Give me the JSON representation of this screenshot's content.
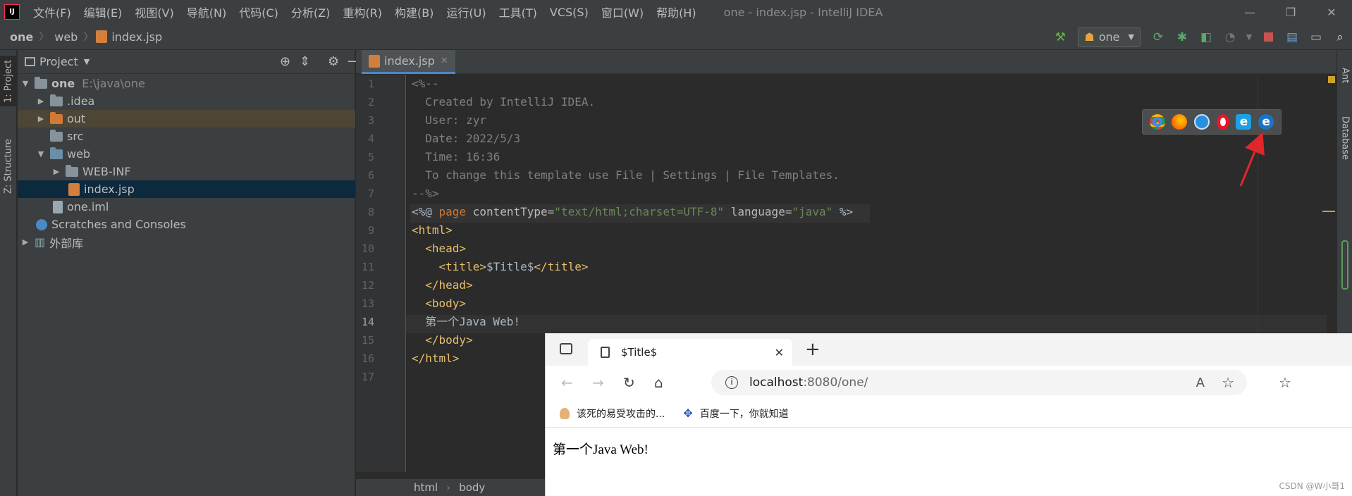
{
  "app": {
    "logo_text": "IJ",
    "window_title": "one - index.jsp - IntelliJ IDEA",
    "menu": [
      "文件(F)",
      "编辑(E)",
      "视图(V)",
      "导航(N)",
      "代码(C)",
      "分析(Z)",
      "重构(R)",
      "构建(B)",
      "运行(U)",
      "工具(T)",
      "VCS(S)",
      "窗口(W)",
      "帮助(H)"
    ],
    "window_controls": [
      "—",
      "❐",
      "✕"
    ]
  },
  "breadcrumb": [
    "one",
    "web",
    "index.jsp"
  ],
  "toolbar": {
    "run_config": "one"
  },
  "left_stripe": {
    "project_tab": "1: Project",
    "structure_tab": "Z: Structure"
  },
  "right_stripe": {
    "ant_tab": "Ant",
    "database_tab": "Database"
  },
  "project_panel": {
    "title": "Project",
    "tree": [
      {
        "label": "one",
        "path": "E:\\java\\one"
      },
      {
        "label": ".idea"
      },
      {
        "label": "out"
      },
      {
        "label": "src"
      },
      {
        "label": "web"
      },
      {
        "label": "WEB-INF"
      },
      {
        "label": "index.jsp"
      },
      {
        "label": "one.iml"
      },
      {
        "label": "Scratches and Consoles"
      },
      {
        "label": "外部库"
      }
    ]
  },
  "editor": {
    "tab": "index.jsp",
    "line_numbers": [
      "1",
      "2",
      "3",
      "4",
      "5",
      "6",
      "7",
      "8",
      "9",
      "10",
      "11",
      "12",
      "13",
      "14",
      "15",
      "16",
      "17"
    ],
    "code": {
      "l1": "<%--",
      "l2": "  Created by IntelliJ IDEA.",
      "l3": "  User: zyr",
      "l4": "  Date: 2022/5/3",
      "l5": "  Time: 16:36",
      "l6": "  To change this template use File | Settings | File Templates.",
      "l7": "--%>",
      "l8a": "<%@ ",
      "l8b": "page",
      "l8c": " contentType=",
      "l8d": "\"text/html;charset=UTF-8\"",
      "l8e": " language=",
      "l8f": "\"java\"",
      "l8g": " %>",
      "l9": "<html>",
      "l10": "  <head>",
      "l11a": "    <title>",
      "l11b": "$Title$",
      "l11c": "</title>",
      "l12": "  </head>",
      "l13": "  <body>",
      "l14": "  第一个Java Web!",
      "l15": "  </body>",
      "l16": "</html>"
    },
    "status_path": [
      "html",
      "body"
    ]
  },
  "browser": {
    "tab_title": "$Title$",
    "url_host": "localhost",
    "url_rest": ":8080/one/",
    "favorites": [
      "该死的易受攻击的...",
      "百度一下，你就知道"
    ],
    "content": "第一个Java Web!"
  },
  "watermark": "CSDN @W小哥1",
  "colors": {
    "accent_red": "#e0262b",
    "tab_underline": "#4a88c7"
  }
}
